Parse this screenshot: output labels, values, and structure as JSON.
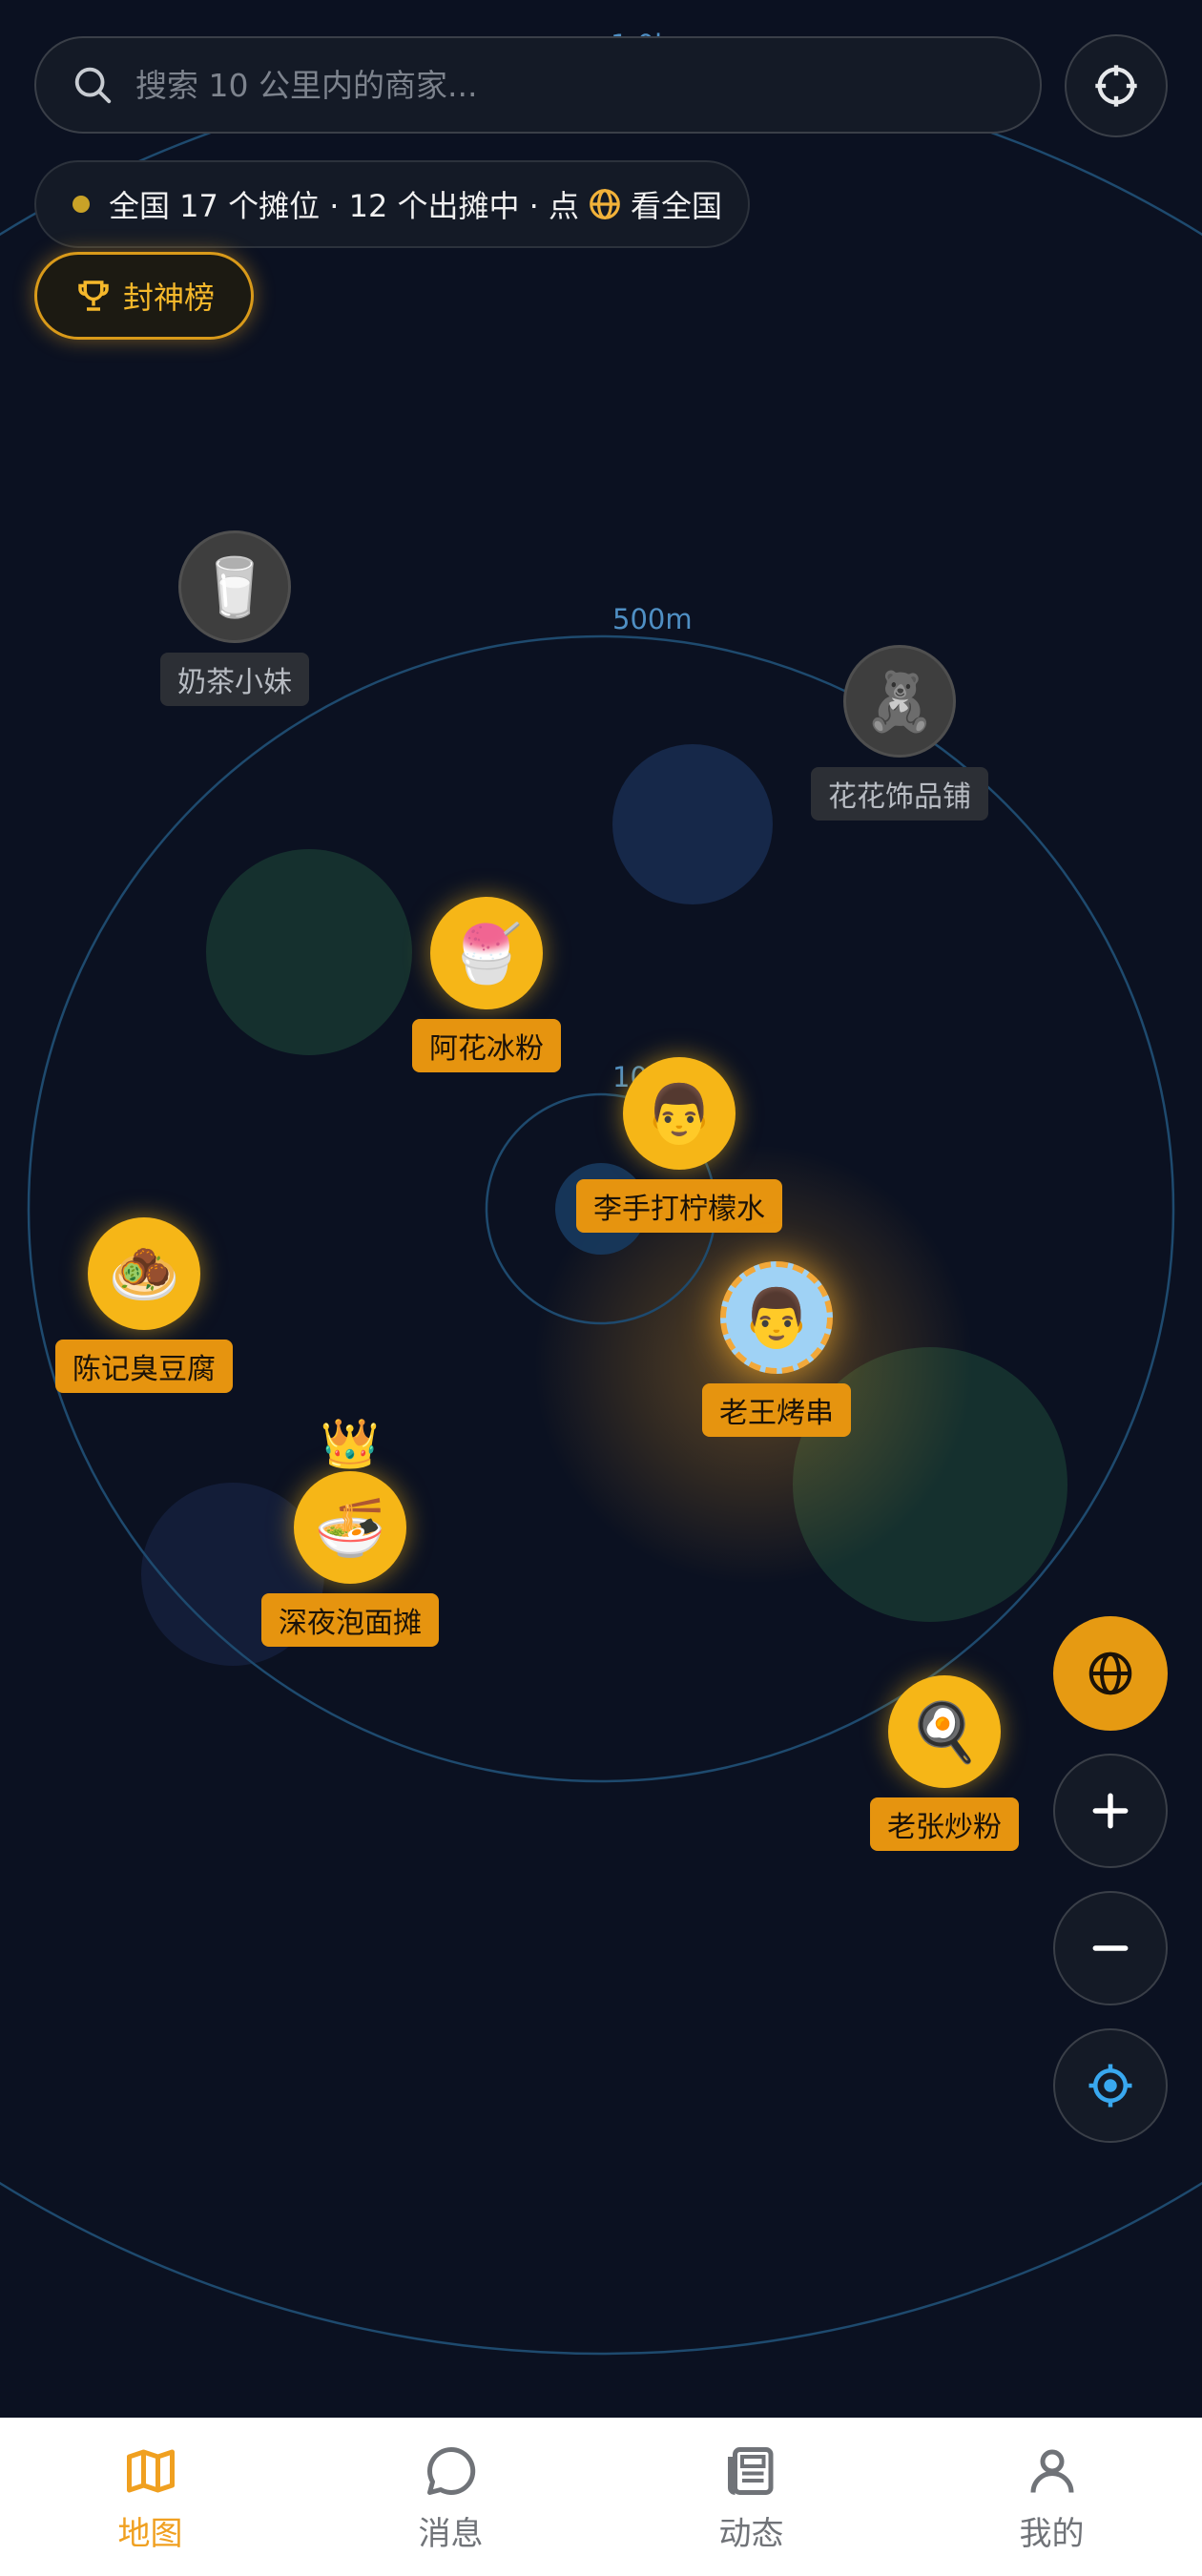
{
  "search": {
    "placeholder": "搜索 10 公里内的商家..."
  },
  "status": {
    "part1": "全国 17 个摊位 · 12 个出摊中 · 点",
    "part2": "看全国"
  },
  "hall_of_fame": {
    "label": "封神榜"
  },
  "rings": {
    "outer": "1.0km",
    "mid": "500m",
    "inner": "100m"
  },
  "stalls": [
    {
      "name": "奶茶小妹",
      "icon": "🥛",
      "open": false
    },
    {
      "name": "花花饰品铺",
      "icon": "🧸",
      "open": false
    },
    {
      "name": "阿花冰粉",
      "icon": "🍧",
      "open": true
    },
    {
      "name": "李手打柠檬水",
      "icon": "👨",
      "open": true
    },
    {
      "name": "老王烤串",
      "icon": "👨",
      "open": true,
      "featured": true
    },
    {
      "name": "陈记臭豆腐",
      "icon": "🧆",
      "open": true
    },
    {
      "name": "深夜泡面摊",
      "icon": "🍜",
      "open": true,
      "crowned": true
    },
    {
      "name": "老张炒粉",
      "icon": "🍳",
      "open": true
    }
  ],
  "controls": [
    "globe-icon",
    "zoom-in-icon",
    "zoom-out-icon",
    "my-location-icon"
  ],
  "nav": [
    {
      "label": "地图",
      "icon": "map-icon",
      "active": true
    },
    {
      "label": "消息",
      "icon": "chat-icon",
      "active": false
    },
    {
      "label": "动态",
      "icon": "news-icon",
      "active": false
    },
    {
      "label": "我的",
      "icon": "user-icon",
      "active": false
    }
  ],
  "colors": {
    "accent": "#e69a12",
    "background": "#0b1121",
    "ring": "#1e4a6e",
    "user_dot": "#39a8ef"
  }
}
